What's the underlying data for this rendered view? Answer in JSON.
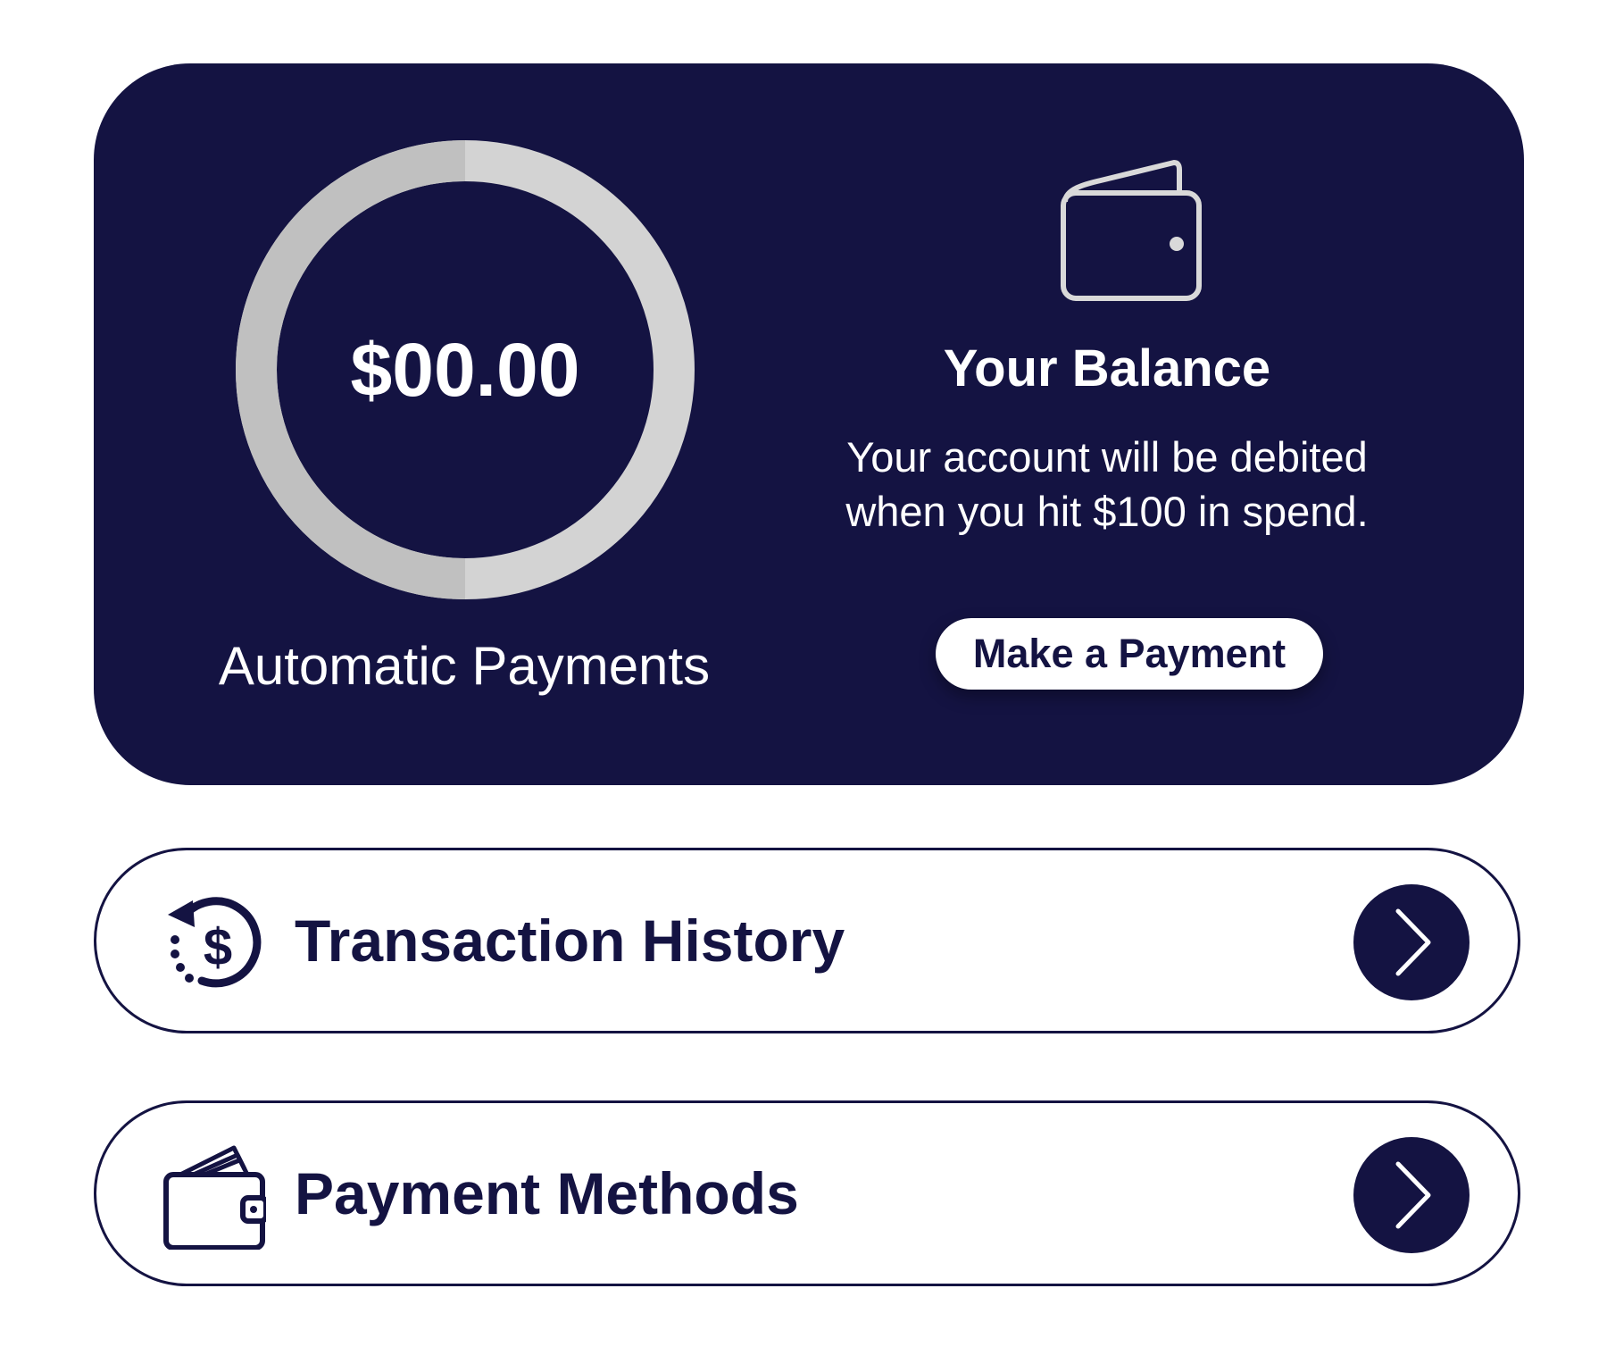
{
  "balance_card": {
    "amount": "$00.00",
    "progress_fraction": 0.5,
    "auto_payments_label": "Automatic Payments",
    "icon": "wallet-icon",
    "title": "Your Balance",
    "description_line1": "Your account will be debited",
    "description_line2": "when you hit $100 in spend.",
    "pay_button_label": "Make a Payment"
  },
  "menu": {
    "transactions": {
      "label": "Transaction History",
      "icon": "dollar-history-icon"
    },
    "methods": {
      "label": "Payment Methods",
      "icon": "wallet-cards-icon"
    },
    "arrow_icon": "chevron-right-icon"
  },
  "colors": {
    "navy": "#141342",
    "ring_track": "#d3d3d3",
    "ring_fill": "#c0c0c0",
    "white": "#ffffff"
  }
}
